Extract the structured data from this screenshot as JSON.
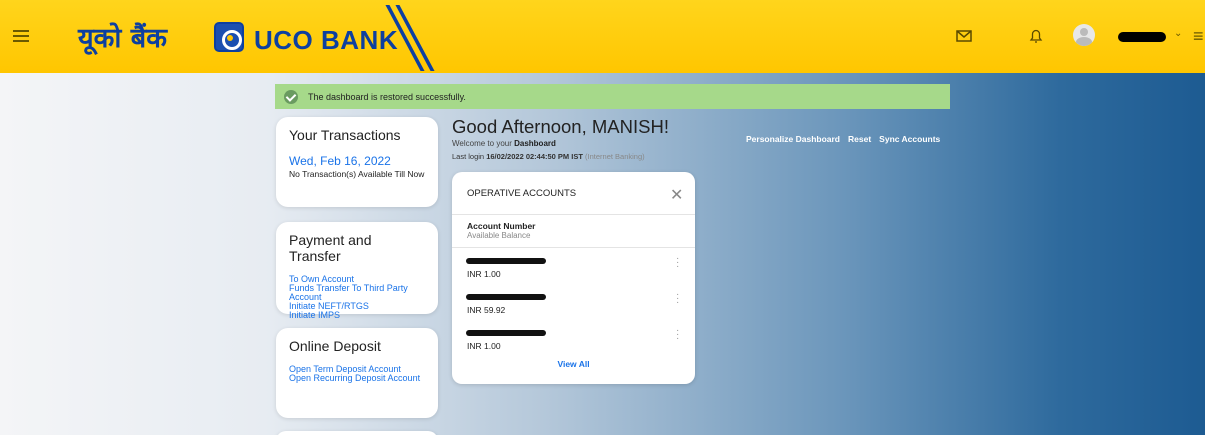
{
  "header": {
    "logo_hindi": "यूको बैंक",
    "logo_english": "UCO BANK",
    "icons": [
      "menu-icon",
      "mail-icon",
      "bell-icon",
      "avatar-icon",
      "chevron-down-icon"
    ],
    "brand_color": "#ffc600"
  },
  "toast": {
    "message": "The dashboard is restored successfully.",
    "color": "#a6d98a"
  },
  "transactions_card": {
    "title": "Your Transactions",
    "date": "Wed, Feb 16, 2022",
    "empty_text": "No Transaction(s) Available Till Now"
  },
  "payment_card": {
    "title": "Payment and Transfer",
    "links": [
      "To Own Account",
      "Funds Transfer To Third Party Account",
      "Initiate NEFT/RTGS",
      "Initiate IMPS"
    ]
  },
  "deposit_card": {
    "title": "Online Deposit",
    "links": [
      "Open Term Deposit Account",
      "Open Recurring Deposit Account"
    ]
  },
  "greeting": {
    "title": "Good Afternoon, MANISH!",
    "welcome_prefix": "Welcome to your ",
    "welcome_bold": "Dashboard",
    "last_login_label": "Last login",
    "last_login_value": "16/02/2022 02:44:50 PM IST",
    "last_login_mode": "(Internet Banking)"
  },
  "top_links": [
    "Personalize Dashboard",
    "Reset",
    "Sync Accounts"
  ],
  "operative_accounts": {
    "title": "OPERATIVE ACCOUNTS",
    "col_header": "Account Number",
    "col_sub": "Available Balance",
    "accounts": [
      {
        "balance": "INR 1.00"
      },
      {
        "balance": "INR 59.92"
      },
      {
        "balance": "INR 1.00"
      }
    ],
    "view_all": "View All"
  }
}
